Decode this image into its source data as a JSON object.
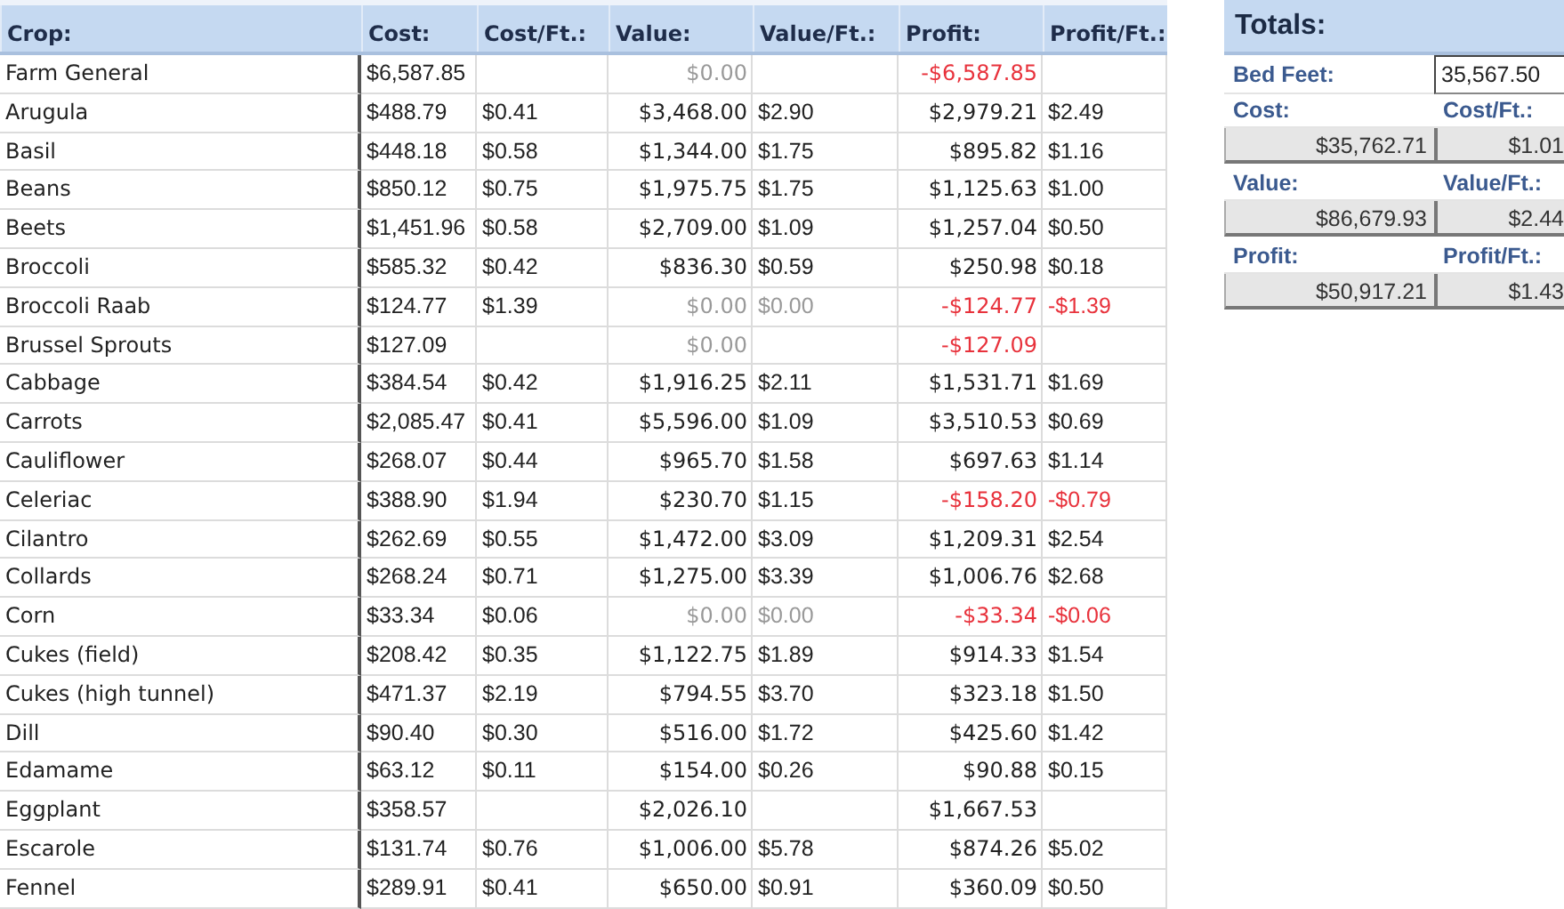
{
  "table": {
    "columns": [
      "Crop:",
      "Cost:",
      "Cost/Ft.:",
      "Value:",
      "Value/Ft.:",
      "Profit:",
      "Profit/Ft.:"
    ],
    "rows": [
      {
        "crop": "Farm General",
        "cost": "$6,587.85",
        "value": "$0.00",
        "profit": "-$6,587.85",
        "value_muted": true,
        "negative": true
      },
      {
        "crop": "Arugula",
        "cost": "$488.79",
        "cost_ft": "$0.41",
        "value": "$3,468.00",
        "value_ft": "$2.90",
        "profit": "$2,979.21",
        "profit_ft": "$2.49",
        "value_muted": false,
        "negative": false
      },
      {
        "crop": "Basil",
        "cost": "$448.18",
        "cost_ft": "$0.58",
        "value": "$1,344.00",
        "value_ft": "$1.75",
        "profit": "$895.82",
        "profit_ft": "$1.16",
        "value_muted": false,
        "negative": false
      },
      {
        "crop": "Beans",
        "cost": "$850.12",
        "cost_ft": "$0.75",
        "value": "$1,975.75",
        "value_ft": "$1.75",
        "profit": "$1,125.63",
        "profit_ft": "$1.00",
        "value_muted": false,
        "negative": false
      },
      {
        "crop": "Beets",
        "cost": "$1,451.96",
        "cost_ft": "$0.58",
        "value": "$2,709.00",
        "value_ft": "$1.09",
        "profit": "$1,257.04",
        "profit_ft": "$0.50",
        "value_muted": false,
        "negative": false
      },
      {
        "crop": "Broccoli",
        "cost": "$585.32",
        "cost_ft": "$0.42",
        "value": "$836.30",
        "value_ft": "$0.59",
        "profit": "$250.98",
        "profit_ft": "$0.18",
        "value_muted": false,
        "negative": false
      },
      {
        "crop": "Broccoli Raab",
        "cost": "$124.77",
        "cost_ft": "$1.39",
        "value": "$0.00",
        "value_ft": "$0.00",
        "profit": "-$124.77",
        "profit_ft": "-$1.39",
        "value_muted": true,
        "negative": true
      },
      {
        "crop": "Brussel Sprouts",
        "cost": "$127.09",
        "value": "$0.00",
        "profit": "-$127.09",
        "value_muted": true,
        "negative": true
      },
      {
        "crop": "Cabbage",
        "cost": "$384.54",
        "cost_ft": "$0.42",
        "value": "$1,916.25",
        "value_ft": "$2.11",
        "profit": "$1,531.71",
        "profit_ft": "$1.69",
        "value_muted": false,
        "negative": false
      },
      {
        "crop": "Carrots",
        "cost": "$2,085.47",
        "cost_ft": "$0.41",
        "value": "$5,596.00",
        "value_ft": "$1.09",
        "profit": "$3,510.53",
        "profit_ft": "$0.69",
        "value_muted": false,
        "negative": false
      },
      {
        "crop": "Cauliflower",
        "cost": "$268.07",
        "cost_ft": "$0.44",
        "value": "$965.70",
        "value_ft": "$1.58",
        "profit": "$697.63",
        "profit_ft": "$1.14",
        "value_muted": false,
        "negative": false
      },
      {
        "crop": "Celeriac",
        "cost": "$388.90",
        "cost_ft": "$1.94",
        "value": "$230.70",
        "value_ft": "$1.15",
        "profit": "-$158.20",
        "profit_ft": "-$0.79",
        "value_muted": false,
        "negative": true
      },
      {
        "crop": "Cilantro",
        "cost": "$262.69",
        "cost_ft": "$0.55",
        "value": "$1,472.00",
        "value_ft": "$3.09",
        "profit": "$1,209.31",
        "profit_ft": "$2.54",
        "value_muted": false,
        "negative": false
      },
      {
        "crop": "Collards",
        "cost": "$268.24",
        "cost_ft": "$0.71",
        "value": "$1,275.00",
        "value_ft": "$3.39",
        "profit": "$1,006.76",
        "profit_ft": "$2.68",
        "value_muted": false,
        "negative": false
      },
      {
        "crop": "Corn",
        "cost": "$33.34",
        "cost_ft": "$0.06",
        "value": "$0.00",
        "value_ft": "$0.00",
        "profit": "-$33.34",
        "profit_ft": "-$0.06",
        "value_muted": true,
        "negative": true
      },
      {
        "crop": "Cukes (field)",
        "cost": "$208.42",
        "cost_ft": "$0.35",
        "value": "$1,122.75",
        "value_ft": "$1.89",
        "profit": "$914.33",
        "profit_ft": "$1.54",
        "value_muted": false,
        "negative": false
      },
      {
        "crop": "Cukes (high tunnel)",
        "cost": "$471.37",
        "cost_ft": "$2.19",
        "value": "$794.55",
        "value_ft": "$3.70",
        "profit": "$323.18",
        "profit_ft": "$1.50",
        "value_muted": false,
        "negative": false
      },
      {
        "crop": "Dill",
        "cost": "$90.40",
        "cost_ft": "$0.30",
        "value": "$516.00",
        "value_ft": "$1.72",
        "profit": "$425.60",
        "profit_ft": "$1.42",
        "value_muted": false,
        "negative": false
      },
      {
        "crop": "Edamame",
        "cost": "$63.12",
        "cost_ft": "$0.11",
        "value": "$154.00",
        "value_ft": "$0.26",
        "profit": "$90.88",
        "profit_ft": "$0.15",
        "value_muted": false,
        "negative": false
      },
      {
        "crop": "Eggplant",
        "cost": "$358.57",
        "value": "$2,026.10",
        "profit": "$1,667.53",
        "value_muted": false,
        "negative": false
      },
      {
        "crop": "Escarole",
        "cost": "$131.74",
        "cost_ft": "$0.76",
        "value": "$1,006.00",
        "value_ft": "$5.78",
        "profit": "$874.26",
        "profit_ft": "$5.02",
        "value_muted": false,
        "negative": false
      },
      {
        "crop": "Fennel",
        "cost": "$289.91",
        "cost_ft": "$0.41",
        "value": "$650.00",
        "value_ft": "$0.91",
        "profit": "$360.09",
        "profit_ft": "$0.50",
        "value_muted": false,
        "negative": false
      }
    ]
  },
  "totals": {
    "title": "Totals:",
    "rows": [
      {
        "kind": "field",
        "cells": [
          "Bed Feet:",
          "35,567.50"
        ]
      },
      {
        "kind": "labels",
        "cells": [
          "Cost:",
          "Cost/Ft.:"
        ]
      },
      {
        "kind": "values",
        "cells": [
          "$35,762.71",
          "$1.01"
        ]
      },
      {
        "kind": "labels",
        "cells": [
          "Value:",
          "Value/Ft.:"
        ]
      },
      {
        "kind": "values",
        "cells": [
          "$86,679.93",
          "$2.44"
        ]
      },
      {
        "kind": "labels",
        "cells": [
          "Profit:",
          "Profit/Ft.:"
        ]
      },
      {
        "kind": "values",
        "cells": [
          "$50,917.21",
          "$1.43"
        ]
      }
    ]
  }
}
